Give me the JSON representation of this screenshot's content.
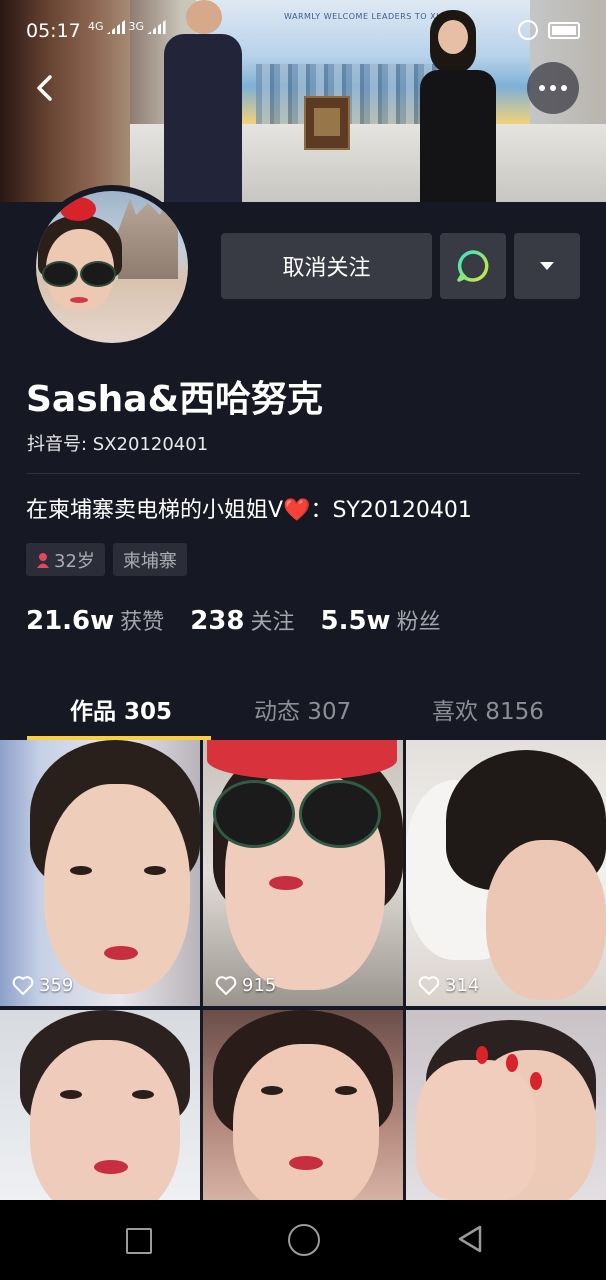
{
  "status_bar": {
    "time": "05:17",
    "network_1": "4G",
    "network_2": "3G"
  },
  "profile": {
    "name": "Sasha&西哈努克",
    "account_id": "抖音号: SX20120401",
    "bio": "在柬埔寨卖电梯的小姐姐V❤️：SY20120401",
    "tags": [
      {
        "icon": "female-user-icon",
        "label": "32岁"
      },
      {
        "label": "柬埔寨"
      }
    ],
    "stats": [
      {
        "value": "21.6w",
        "label": "获赞"
      },
      {
        "value": "238",
        "label": "关注"
      },
      {
        "value": "5.5w",
        "label": "粉丝"
      }
    ]
  },
  "actions": {
    "unfollow_label": "取消关注",
    "chat_icon": "chat-icon",
    "dropdown_icon": "triangle-down-icon"
  },
  "banner": {
    "screen_text": "WARMLY WELCOME LEADERS TO XIOLIFT"
  },
  "tabs": [
    {
      "label": "作品 305",
      "active": true
    },
    {
      "label": "动态 307",
      "active": false
    },
    {
      "label": "喜欢 8156",
      "active": false
    }
  ],
  "videos": [
    {
      "likes": "359"
    },
    {
      "likes": "915"
    },
    {
      "likes": "314"
    },
    {
      "likes": ""
    },
    {
      "likes": ""
    },
    {
      "likes": ""
    }
  ],
  "colors": {
    "background": "#161823",
    "button": "#393b44",
    "tab_indicator": "#f7d046",
    "chat_ring": "#3fe0a6"
  }
}
